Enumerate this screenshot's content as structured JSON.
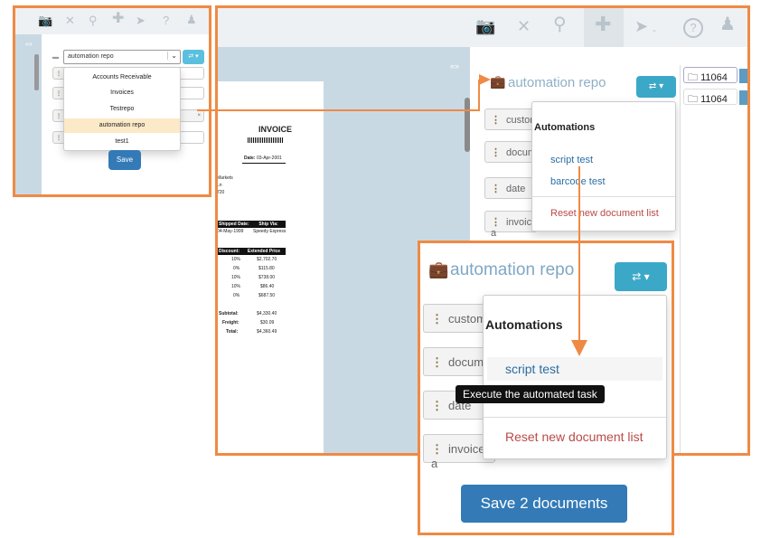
{
  "toolbar": {
    "icons": [
      "camera-icon",
      "close-icon",
      "binoculars-icon",
      "plus-icon",
      "send-icon",
      "help-icon",
      "user-icon"
    ],
    "caret": "-"
  },
  "collapse_arrows": "«»",
  "small_panel": {
    "select_value": "automation repo",
    "dropdown_options": [
      "Accounts Receivable",
      "Invoices",
      "Testrepo",
      "automation repo",
      "test1"
    ],
    "selected_option": "automation repo",
    "field_labels": [
      "cus",
      "doc",
      "dat",
      "inv"
    ],
    "field_values": [
      "this",
      "",
      "",
      "this"
    ],
    "save_label": "Save"
  },
  "main_panel": {
    "repo_title": "automation repo",
    "page_badge": "1",
    "fields": [
      "custome",
      "documen",
      "date",
      "invoice a"
    ],
    "menu_header": "Automations",
    "menu_items": [
      "script test",
      "barcode test"
    ],
    "menu_reset": "Reset new document list",
    "folders": [
      "11064",
      "11064"
    ]
  },
  "invoice": {
    "title": "INVOICE",
    "date_label": "Date:",
    "date_value": "03-Apr-2001",
    "addr": [
      "Markets",
      "Ln",
      "720"
    ],
    "shipped_label": "Shipped Date:",
    "shipvia_label": "Ship Via:",
    "shipped_value": "04-May-1999",
    "shipvia_value": "Speedy Express",
    "discount_label": "Discount:",
    "ext_label": "Extended Price",
    "discounts": [
      "10%",
      "0%",
      "10%",
      "10%",
      "0%"
    ],
    "prices": [
      "$2,702.70",
      "$115.80",
      "$738.00",
      "$86.40",
      "$687.50"
    ],
    "subtotal_label": "Subtotal:",
    "freight_label": "Freight:",
    "total_label": "Total:",
    "subtotal": "$4,330.40",
    "freight": "$30.09",
    "total": "$4,360.49"
  },
  "zoom_panel": {
    "repo_title": "automation repo",
    "fields": [
      "custome",
      "documen",
      "date",
      "invoice a"
    ],
    "menu_header": "Automations",
    "menu_items": [
      "script test"
    ],
    "tooltip": "Execute the automated task",
    "menu_reset": "Reset new document list",
    "save_label": "Save 2 documents"
  },
  "colors": {
    "accent_orange": "#ef8a44",
    "teal": "#3ca8c8",
    "blue": "#337ab7",
    "link": "#2a6ea3",
    "reset": "#b94a48",
    "highlight": "#fbe9c8"
  }
}
